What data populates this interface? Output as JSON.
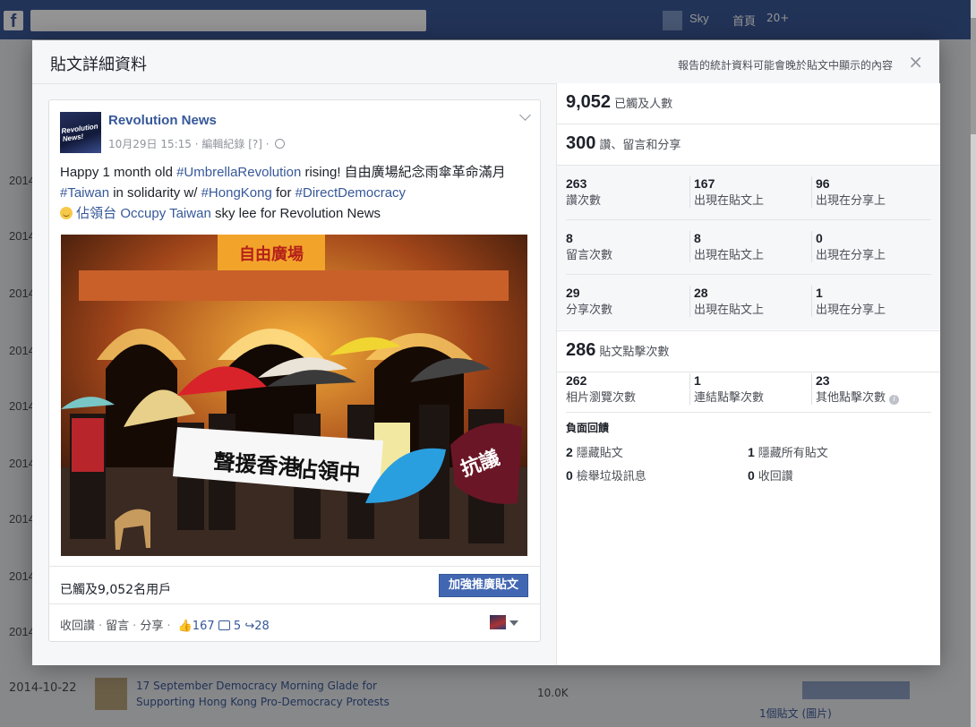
{
  "background": {
    "fb_logo": "f",
    "nav_name": "Sky",
    "nav_home": "首頁",
    "nav_count": "20+",
    "years": [
      "2014",
      "2014",
      "2014",
      "2014",
      "2014",
      "2014",
      "2014",
      "2014",
      "2014",
      "2014",
      "2014"
    ],
    "bottom_row": {
      "date": "2014-10-22",
      "text": "17 September Democracy Morning Glade for Supporting Hong Kong Pro-Democracy Protests",
      "reach": "10.0K",
      "link": "1個貼文 (圖片)"
    }
  },
  "dialog": {
    "title": "貼文詳細資料",
    "note": "報告的統計資料可能會晚於貼文中顯示的內容",
    "close": "×"
  },
  "post": {
    "page_name": "Revolution News",
    "avatar_text": "Revolution News!",
    "date": "10月29日 15:15",
    "meta_sep": " · ",
    "edit_history": "編輯紀錄",
    "edit_help": "[?]",
    "text": {
      "p1": "Happy 1 month old ",
      "tag1": "#UmbrellaRevolution",
      "p2": " rising! 自由廣場紀念雨傘革命滿月 ",
      "tag2": "#Taiwan",
      "p3": " in solidarity w/ ",
      "tag3": "#HongKong",
      "p4": " for ",
      "tag4": "#DirectDemocracy",
      "p5": " 佔領台 ",
      "tag5": "Occupy Taiwan",
      "p6": " sky lee for Revolution News"
    },
    "photo": {
      "gate_sign": "自由廣場",
      "banner_left": "聲援香港",
      "banner_right": "佔領中",
      "flag_text": "抗議"
    },
    "reach_text": "已觸及9,052名用戶",
    "boost_label": "加強推廣貼文",
    "actions": {
      "unlike": "收回讚",
      "comment": "留言",
      "share": "分享",
      "likes": "167",
      "comments": "5",
      "shares": "28"
    }
  },
  "stats": {
    "reach": {
      "value": "9,052",
      "label": "已觸及人數"
    },
    "engagement": {
      "value": "300",
      "label": "讚、留言和分享"
    },
    "rows": [
      {
        "cells": [
          {
            "n": "263",
            "l": "讚次數"
          },
          {
            "n": "167",
            "l": "出現在貼文上"
          },
          {
            "n": "96",
            "l": "出現在分享上"
          }
        ]
      },
      {
        "cells": [
          {
            "n": "8",
            "l": "留言次數"
          },
          {
            "n": "8",
            "l": "出現在貼文上"
          },
          {
            "n": "0",
            "l": "出現在分享上"
          }
        ]
      },
      {
        "cells": [
          {
            "n": "29",
            "l": "分享次數"
          },
          {
            "n": "28",
            "l": "出現在貼文上"
          },
          {
            "n": "1",
            "l": "出現在分享上"
          }
        ]
      }
    ],
    "clicks": {
      "value": "286",
      "label": "貼文點擊次數"
    },
    "click_cells": [
      {
        "n": "262",
        "l": "相片瀏覽次數"
      },
      {
        "n": "1",
        "l": "連結點擊次數"
      },
      {
        "n": "23",
        "l": "其他點擊次數"
      }
    ],
    "negative": {
      "title": "負面回饋",
      "items": [
        {
          "n": "2",
          "l": "隱藏貼文"
        },
        {
          "n": "1",
          "l": "隱藏所有貼文"
        },
        {
          "n": "0",
          "l": "檢舉垃圾訊息"
        },
        {
          "n": "0",
          "l": "收回讚"
        }
      ]
    }
  }
}
